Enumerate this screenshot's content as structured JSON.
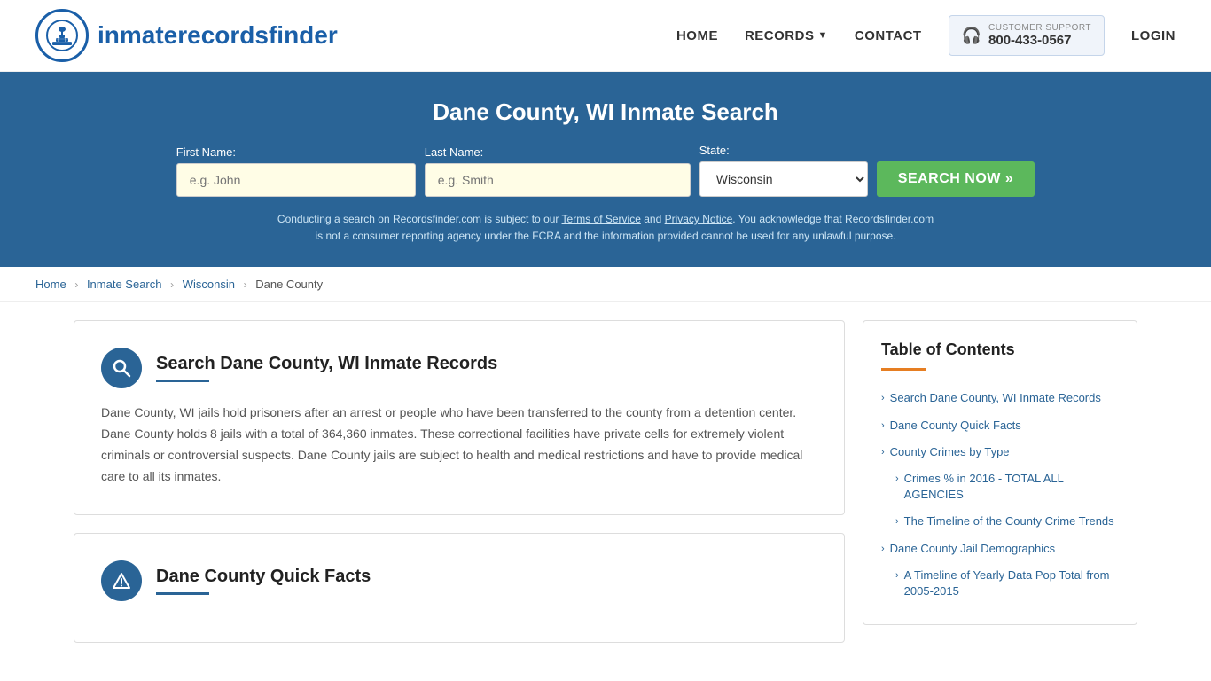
{
  "header": {
    "logo_text_plain": "inmaterecords",
    "logo_text_bold": "finder",
    "nav": {
      "home": "HOME",
      "records": "RECORDS",
      "contact": "CONTACT",
      "login": "LOGIN"
    },
    "support": {
      "label": "CUSTOMER SUPPORT",
      "phone": "800-433-0567"
    }
  },
  "banner": {
    "title": "Dane County, WI Inmate Search",
    "form": {
      "first_name_label": "First Name:",
      "first_name_placeholder": "e.g. John",
      "last_name_label": "Last Name:",
      "last_name_placeholder": "e.g. Smith",
      "state_label": "State:",
      "state_value": "Wisconsin",
      "search_button": "SEARCH NOW »"
    },
    "disclaimer": "Conducting a search on Recordsfinder.com is subject to our Terms of Service and Privacy Notice. You acknowledge that Recordsfinder.com is not a consumer reporting agency under the FCRA and the information provided cannot be used for any unlawful purpose."
  },
  "breadcrumb": {
    "home": "Home",
    "inmate_search": "Inmate Search",
    "state": "Wisconsin",
    "county": "Dane County"
  },
  "main_section": {
    "title": "Search Dane County, WI Inmate Records",
    "body": "Dane County, WI jails hold prisoners after an arrest or people who have been transferred to the county from a detention center. Dane County holds 8 jails with a total of 364,360 inmates. These correctional facilities have private cells for extremely violent criminals or controversial suspects. Dane County jails are subject to health and medical restrictions and have to provide medical care to all its inmates."
  },
  "quick_facts_section": {
    "title": "Dane County Quick Facts"
  },
  "toc": {
    "title": "Table of Contents",
    "items": [
      {
        "label": "Search Dane County, WI Inmate Records",
        "sub": false
      },
      {
        "label": "Dane County Quick Facts",
        "sub": false
      },
      {
        "label": "County Crimes by Type",
        "sub": false
      },
      {
        "label": "Crimes % in 2016 - TOTAL ALL AGENCIES",
        "sub": true
      },
      {
        "label": "The Timeline of the County Crime Trends",
        "sub": true
      },
      {
        "label": "Dane County Jail Demographics",
        "sub": false
      },
      {
        "label": "A Timeline of Yearly Data Pop Total from 2005-2015",
        "sub": true
      }
    ]
  }
}
